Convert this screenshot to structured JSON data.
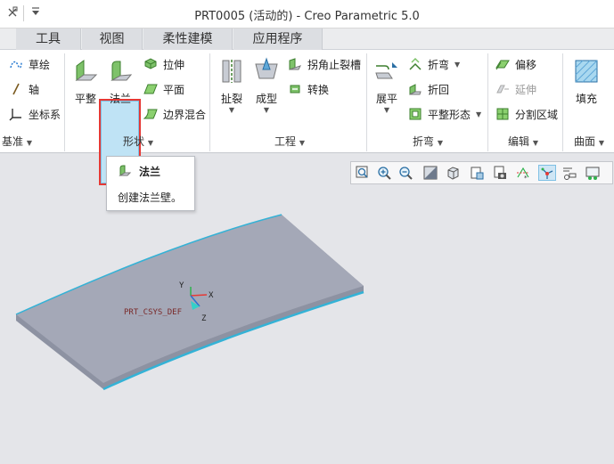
{
  "window": {
    "title": "PRT0005 (活动的) - Creo Parametric 5.0",
    "quick_access": [
      "close-all-icon",
      "customize-dropdown-icon"
    ]
  },
  "tabs": [
    {
      "label": "工具"
    },
    {
      "label": "视图"
    },
    {
      "label": "柔性建模"
    },
    {
      "label": "应用程序"
    }
  ],
  "groups": {
    "datum": {
      "label": "基准",
      "items": [
        "草绘",
        "轴",
        "坐标系"
      ]
    },
    "shapes": {
      "label": "形状",
      "flat_label": "平整",
      "flange_label": "法兰",
      "items": [
        "拉伸",
        "平面",
        "边界混合"
      ]
    },
    "engineering": {
      "label": "工程",
      "rip_label": "扯裂",
      "form_label": "成型",
      "items": [
        "拐角止裂槽",
        "转换"
      ]
    },
    "bends": {
      "label": "折弯",
      "unbend_label": "展平",
      "items": [
        "折弯",
        "折回",
        "平整形态"
      ]
    },
    "editing": {
      "label": "编辑",
      "items": [
        "偏移",
        "延伸",
        "分割区域"
      ]
    },
    "surfaces": {
      "label": "曲面",
      "fill_label": "填充"
    }
  },
  "tooltip": {
    "title": "法兰",
    "description": "创建法兰壁。"
  },
  "model": {
    "csys_label": "PRT_CSYS_DEF",
    "axis_x": "X",
    "axis_y": "Y",
    "axis_z": "Z"
  },
  "colors": {
    "canvas": "#e4e5e9",
    "sheet_top": "#a4a8b7",
    "sheet_edge": "#34b2d6",
    "highlight": "#e53935",
    "hover_fill": "#bfe3f5"
  }
}
